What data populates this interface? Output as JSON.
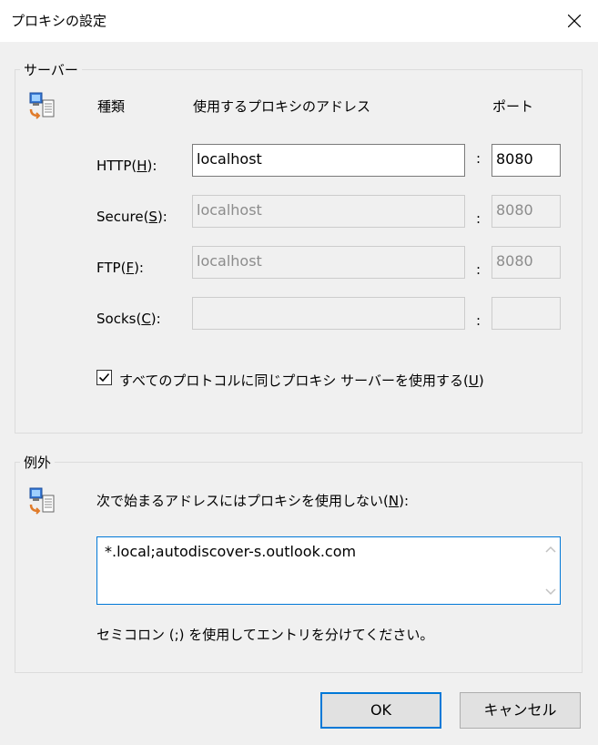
{
  "window": {
    "title": "プロキシの設定"
  },
  "servers": {
    "group_label": "サーバー",
    "type_header": "種類",
    "address_header": "使用するプロキシのアドレス",
    "port_header": "ポート",
    "colon": ":",
    "rows": [
      {
        "label": "HTTP(",
        "mnemonic": "H",
        "suffix": "):",
        "address": "localhost",
        "port": "8080",
        "enabled": true
      },
      {
        "label": "Secure(",
        "mnemonic": "S",
        "suffix": "):",
        "address": "localhost",
        "port": "8080",
        "enabled": false
      },
      {
        "label": "FTP(",
        "mnemonic": "F",
        "suffix": "):",
        "address": "localhost",
        "port": "8080",
        "enabled": false
      },
      {
        "label": "Socks(",
        "mnemonic": "C",
        "suffix": "):",
        "address": "",
        "port": "",
        "enabled": false
      }
    ],
    "same_proxy": {
      "label": "すべてのプロトコルに同じプロキシ サーバーを使用する(",
      "mnemonic": "U",
      "suffix": ")",
      "checked": true
    }
  },
  "exceptions": {
    "group_label": "例外",
    "prompt": "次で始まるアドレスにはプロキシを使用しない(",
    "prompt_mnemonic": "N",
    "prompt_suffix": "):",
    "value": "*.local;autodiscover-s.outlook.com",
    "hint": "セミコロン (;) を使用してエントリを分けてください。"
  },
  "buttons": {
    "ok": "OK",
    "cancel": "キャンセル"
  },
  "colors": {
    "accent": "#0078d7",
    "dialog_bg": "#f0f0f0"
  }
}
